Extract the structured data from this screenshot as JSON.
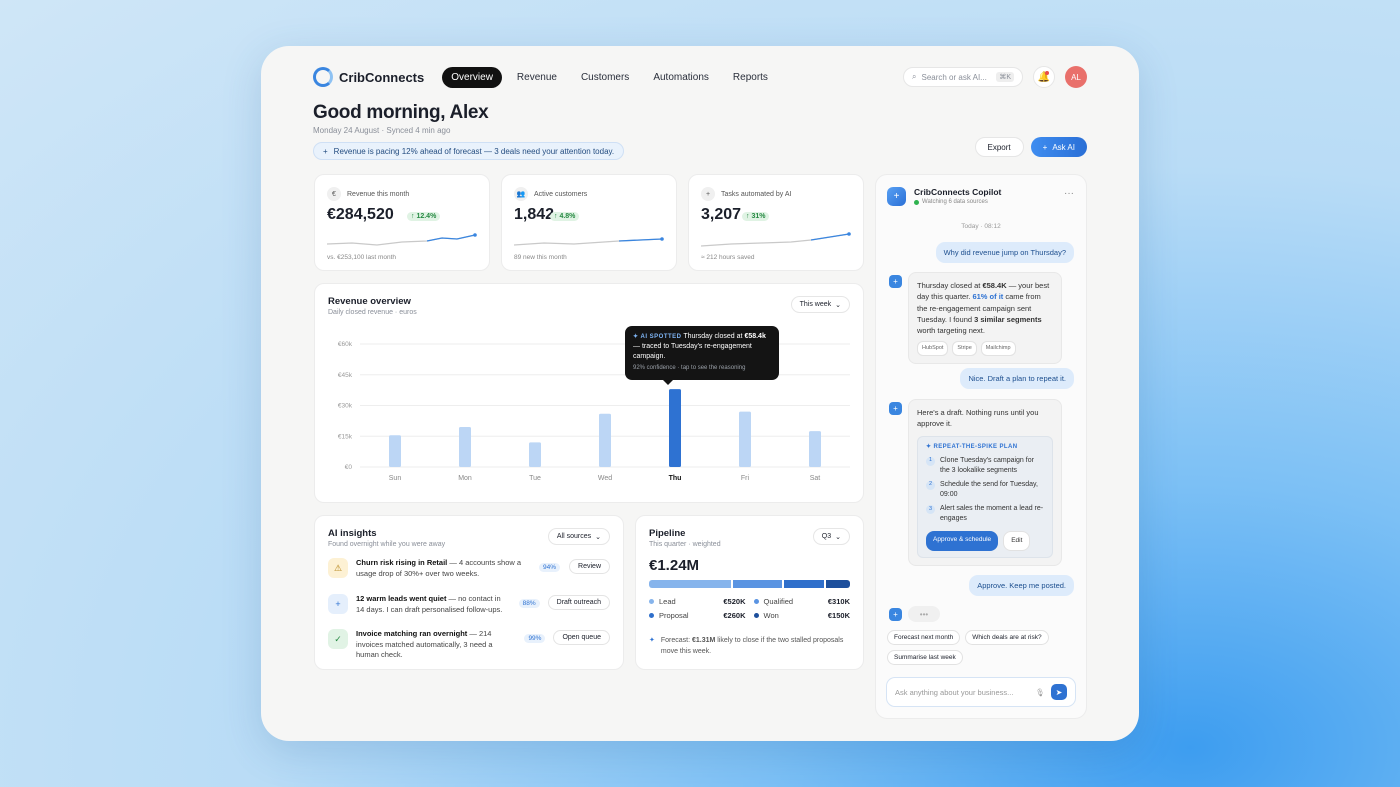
{
  "nav": {
    "brand": "CribConnects",
    "tabs": [
      "Overview",
      "Revenue",
      "Customers",
      "Automations",
      "Reports"
    ],
    "search_placeholder": "Search or ask AI...",
    "shortcut": "⌘K",
    "avatar": "AL"
  },
  "header": {
    "greeting": "Good morning, Alex",
    "subtitle": "Monday 24 August · Synced 4 min ago",
    "alert": "Revenue is pacing 12% ahead of forecast — 3 deals need your attention today.",
    "export_label": "Export",
    "ask_ai_label": "Ask AI"
  },
  "kpis": [
    {
      "label": "Revenue this month",
      "value": "€284,520",
      "delta": "↑ 12.4%",
      "foot": "vs. €253,100 last month",
      "icon": "€"
    },
    {
      "label": "Active customers",
      "value": "1,842",
      "delta": "↑ 4.8%",
      "foot": "89 new this month",
      "icon": "👥"
    },
    {
      "label": "Tasks automated by AI",
      "value": "3,207",
      "delta": "↑ 31%",
      "foot": "≈ 212 hours saved",
      "icon": "+"
    }
  ],
  "revenue": {
    "title": "Revenue overview",
    "subtitle": "Daily closed revenue · euros",
    "range": "This week",
    "tooltip": {
      "tag": "AI SPOTTED",
      "text_a": "Thursday closed at",
      "value": "€58.4k",
      "text_b": "— traced to Tuesday's re-engagement campaign.",
      "note": "92% confidence · tap to see the reasoning"
    }
  },
  "chart_data": {
    "type": "bar",
    "categories": [
      "Sun",
      "Mon",
      "Tue",
      "Wed",
      "Thu",
      "Fri",
      "Sat"
    ],
    "values": [
      15.5,
      19.5,
      12,
      26,
      38,
      27,
      17.5
    ],
    "ylabels": [
      "€60k",
      "€45k",
      "€30k",
      "€15k",
      "€0"
    ],
    "ylim": [
      0,
      60
    ],
    "highlight": "Thu",
    "colors": {
      "bar": "#bcd6f5",
      "highlight": "#2e72d2"
    }
  },
  "insights": {
    "title": "AI insights",
    "subtitle": "Found overnight while you were away",
    "filter": "All sources",
    "items": [
      {
        "bold": "Churn risk rising in Retail",
        "text": " — 4 accounts show a usage drop of 30%+ over two weeks.",
        "pct": "94%",
        "action": "Review",
        "icon": "warning-icon"
      },
      {
        "bold": "12 warm leads went quiet",
        "text": " — no contact in 14 days. I can draft personalised follow-ups.",
        "pct": "88%",
        "action": "Draft outreach",
        "icon": "sparkle-icon"
      },
      {
        "bold": "Invoice matching ran overnight",
        "text": " — 214 invoices matched automatically, 3 need a human check.",
        "pct": "99%",
        "action": "Open queue",
        "icon": "check-icon"
      }
    ]
  },
  "pipeline": {
    "title": "Pipeline",
    "subtitle": "This quarter · weighted",
    "period": "Q3",
    "total": "€1.24M",
    "stages": [
      {
        "name": "Lead",
        "value": "€520K",
        "color": "#86b4ec"
      },
      {
        "name": "Qualified",
        "value": "€310K",
        "color": "#5a94e2"
      },
      {
        "name": "Proposal",
        "value": "€260K",
        "color": "#2f6fcb"
      },
      {
        "name": "Won",
        "value": "€150K",
        "color": "#1d4f9c"
      }
    ],
    "forecast_a": "Forecast: ",
    "forecast_bold": "€1.31M",
    "forecast_b": " likely to close if the two stalled proposals move this week."
  },
  "copilot": {
    "name": "CribConnects Copilot",
    "sources": "Watching 6 data sources",
    "time": "Today · 08:12",
    "q1": "Why did revenue jump on Thursday?",
    "a1": {
      "p1": "Thursday closed at ",
      "b1": "€58.4K",
      "p2": " — your best day this quarter. ",
      "b2": "61% of it",
      "p3": " came from the re-engagement campaign sent Tuesday. I found ",
      "b3": "3 similar segments",
      "p4": " worth targeting next.",
      "chips": [
        "HubSpot",
        "Stripe",
        "Mailchimp"
      ]
    },
    "q2": "Nice. Draft a plan to repeat it.",
    "a2": {
      "intro": "Here's a draft. Nothing runs until you approve it.",
      "plan": "REPEAT-THE-SPIKE PLAN",
      "steps": [
        "Clone Tuesday's campaign for the 3 lookalike segments",
        "Schedule the send for Tuesday, 09:00",
        "Alert sales the moment a lead re-engages"
      ],
      "approve": "Approve & schedule",
      "edit": "Edit"
    },
    "q3": "Approve. Keep me posted.",
    "suggestions": [
      "Forecast next month",
      "Which deals are at risk?",
      "Summarise last week"
    ],
    "input_placeholder": "Ask anything about your business..."
  }
}
